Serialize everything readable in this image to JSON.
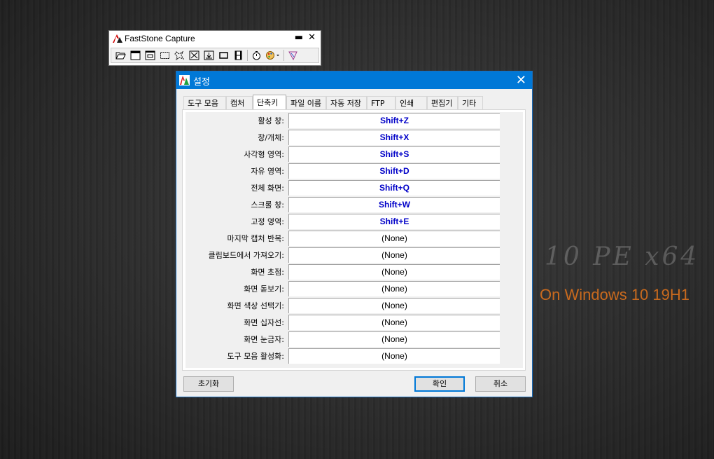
{
  "desktop": {
    "watermark_line1": "10 PE x64",
    "watermark_line2": "On Windows 10 19H1"
  },
  "faststone": {
    "title": "FastStone Capture",
    "minimize_glyph": "▬",
    "close_glyph": "✕",
    "tools": [
      "open-icon",
      "capture-active-window-icon",
      "capture-window-object-icon",
      "capture-rectangle-icon",
      "capture-freehand-icon",
      "capture-fullscreen-icon",
      "capture-scrolling-icon",
      "capture-fixed-region-icon",
      "screen-recorder-icon",
      "delay-timer-icon",
      "output-options-icon",
      "settings-icon"
    ]
  },
  "dialog": {
    "title": "설정",
    "close_glyph": "✕",
    "tabs": [
      "도구 모음",
      "캡처",
      "단축키",
      "파일 이름",
      "자동 저장",
      "FTP",
      "인쇄",
      "편집기",
      "기타"
    ],
    "active_tab": 2,
    "hotkeys": [
      {
        "label": "활성 창:",
        "value": "Shift+Z",
        "assigned": true
      },
      {
        "label": "창/개체:",
        "value": "Shift+X",
        "assigned": true
      },
      {
        "label": "사각형 영역:",
        "value": "Shift+S",
        "assigned": true
      },
      {
        "label": "자유 영역:",
        "value": "Shift+D",
        "assigned": true
      },
      {
        "label": "전체 화면:",
        "value": "Shift+Q",
        "assigned": true
      },
      {
        "label": "스크롤 창:",
        "value": "Shift+W",
        "assigned": true
      },
      {
        "label": "고정 영역:",
        "value": "Shift+E",
        "assigned": true
      },
      {
        "label": "마지막 캡처 반복:",
        "value": "(None)",
        "assigned": false
      },
      {
        "label": "클립보드에서 가져오기:",
        "value": "(None)",
        "assigned": false
      },
      {
        "label": "화면 초점:",
        "value": "(None)",
        "assigned": false
      },
      {
        "label": "화면 돋보기:",
        "value": "(None)",
        "assigned": false
      },
      {
        "label": "화면 색상 선택기:",
        "value": "(None)",
        "assigned": false
      },
      {
        "label": "화면 십자선:",
        "value": "(None)",
        "assigned": false
      },
      {
        "label": "화면 눈금자:",
        "value": "(None)",
        "assigned": false
      },
      {
        "label": "도구 모음 활성화:",
        "value": "(None)",
        "assigned": false
      }
    ],
    "buttons": {
      "reset": "초기화",
      "ok": "확인",
      "cancel": "취소"
    }
  }
}
